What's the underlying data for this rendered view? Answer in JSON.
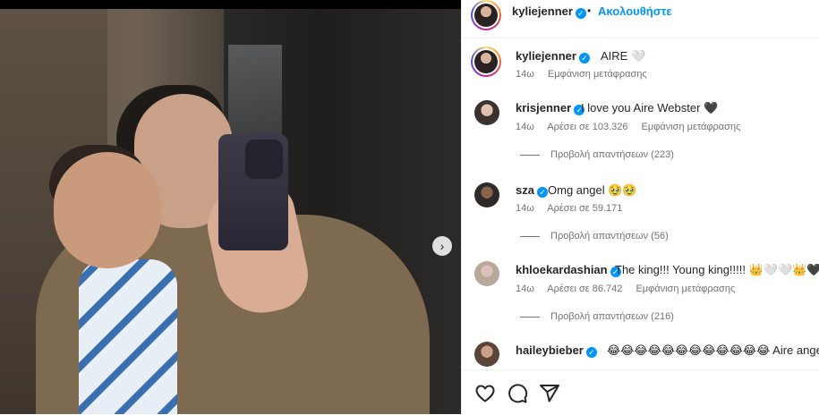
{
  "post": {
    "media_next_glyph": "›"
  },
  "header": {
    "username": "kyliejenner",
    "separator": "•",
    "follow_label": "Ακολουθήστε"
  },
  "caption": {
    "username": "kyliejenner",
    "text": "AIRE 🤍",
    "time": "14ω",
    "translate": "Εμφάνιση μετάφρασης"
  },
  "comments": [
    {
      "username": "krisjenner",
      "text": "I love you Aire Webster 🖤",
      "time": "14ω",
      "likes": "Αρέσει σε 103.326",
      "translate": "Εμφάνιση μετάφρασης",
      "replies": "Προβολή απαντήσεων (223)"
    },
    {
      "username": "sza",
      "text": "Omg angel 🥹🥹",
      "time": "14ω",
      "likes": "Αρέσει σε 59.171",
      "translate": "",
      "replies": "Προβολή απαντήσεων (56)"
    },
    {
      "username": "khloekardashian",
      "text": "The king!!! Young king!!!!! 👑🤍🤍👑🖤",
      "time": "14ω",
      "likes": "Αρέσει σε 86.742",
      "translate": "Εμφάνιση μετάφρασης",
      "replies": "Προβολή απαντήσεων (216)"
    },
    {
      "username": "haileybieber",
      "text": "😂😂😂😂😂😂😂😂😂😂😂😂 Aire angel",
      "time": "",
      "likes": "",
      "translate": "",
      "replies": ""
    }
  ],
  "icons": [
    "heart-icon",
    "comment-icon",
    "share-icon",
    "verified-badge-icon",
    "chevron-right-icon"
  ],
  "colors": {
    "accent": "#0095f6",
    "text": "#262626",
    "muted": "#737373"
  }
}
